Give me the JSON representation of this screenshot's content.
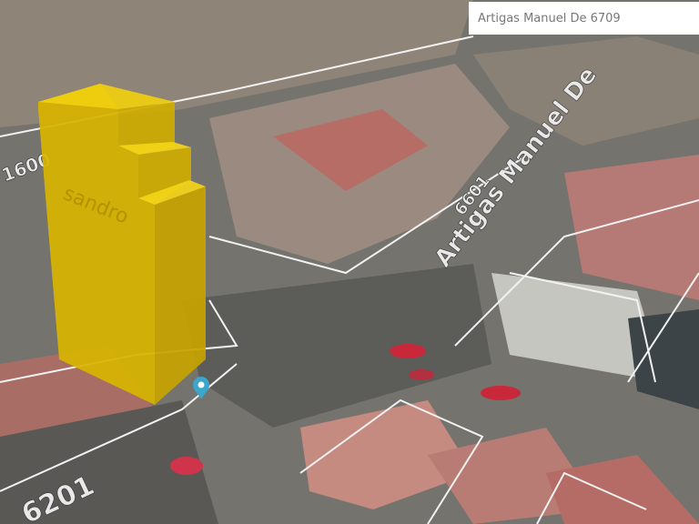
{
  "search": {
    "value": "Artigas Manuel De 6709"
  },
  "map_labels": {
    "street_name": "Artigas Manuel De",
    "street_number_1": "6601",
    "street_number_2": "6201",
    "street_number_3": "1600",
    "street_partial": "sandro"
  },
  "colors": {
    "building": "#e6c200",
    "pin": "#3aa6c9",
    "roof_red": "#c47a70"
  }
}
